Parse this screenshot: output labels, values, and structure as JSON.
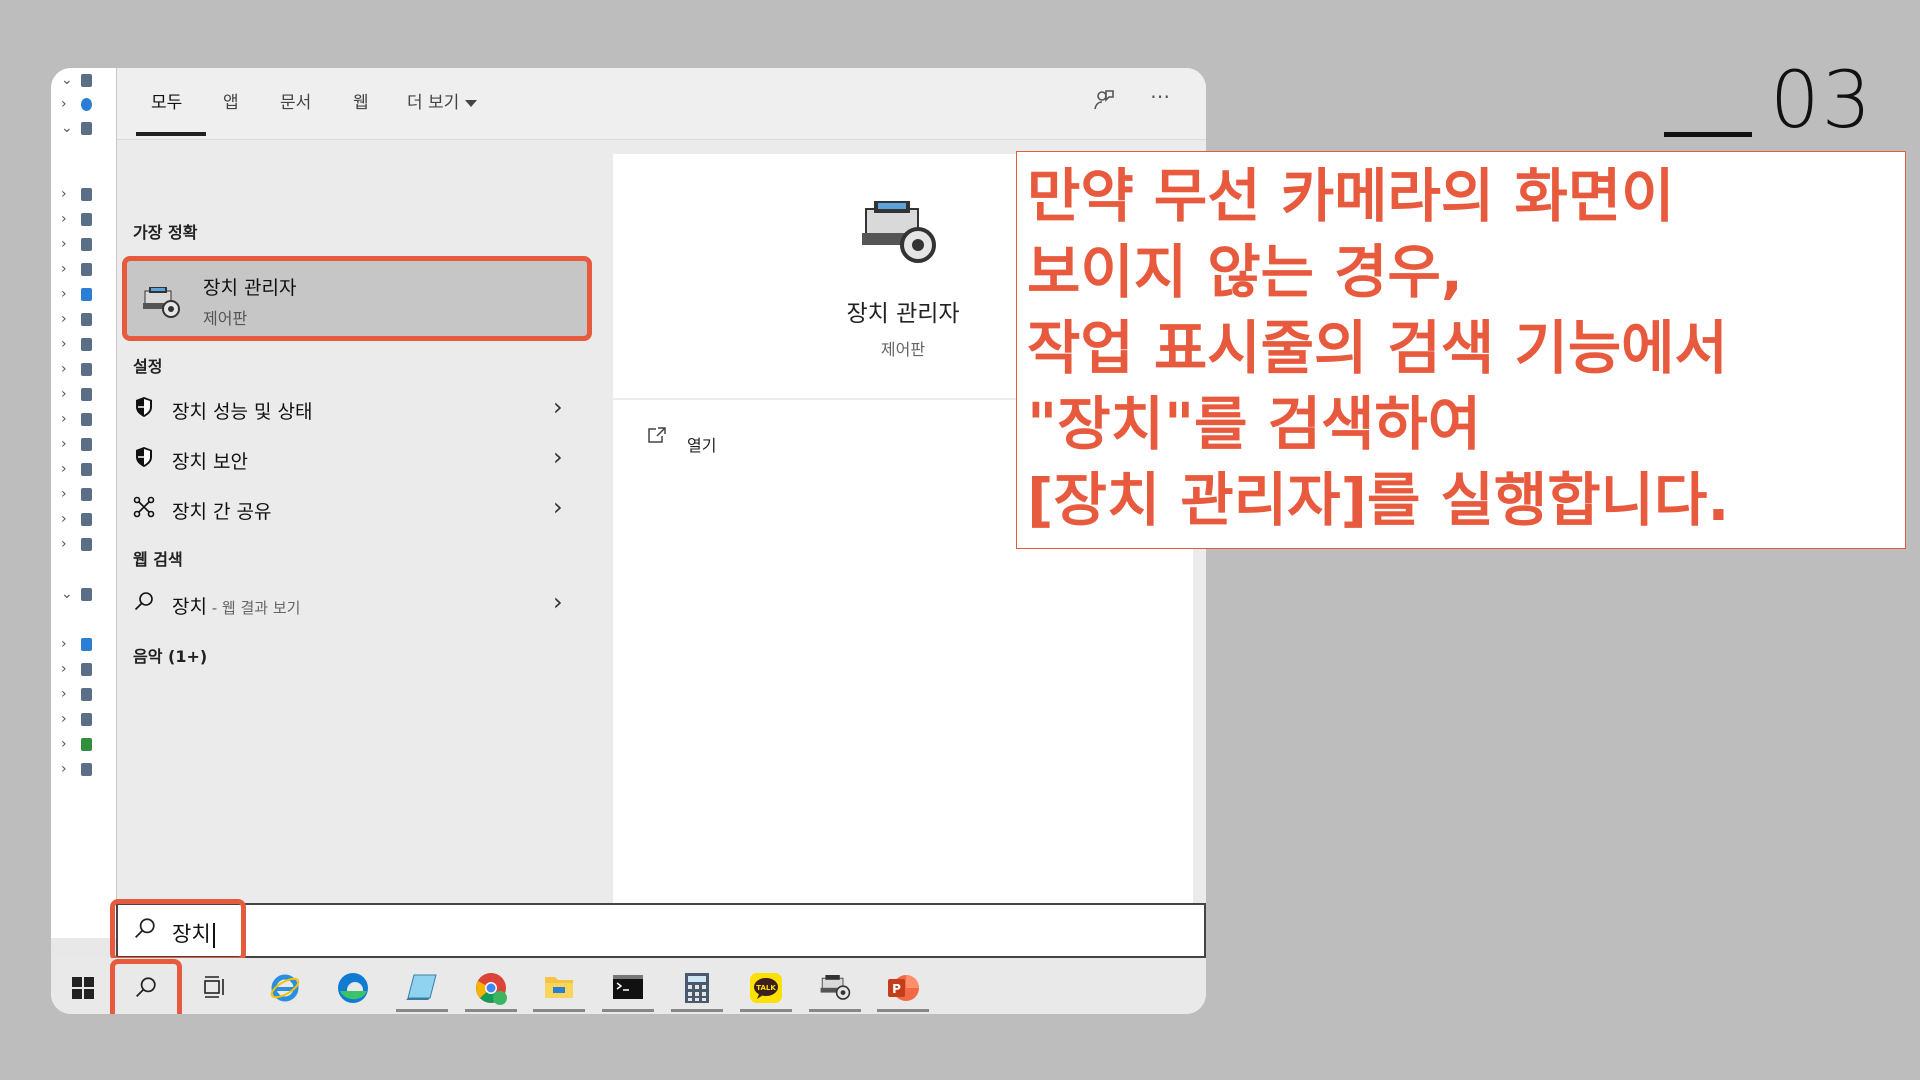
{
  "slide_number": "03",
  "tabs": [
    "모두",
    "앱",
    "문서",
    "웹",
    "더 보기"
  ],
  "tab_icons": [
    "feedback-icon",
    "more-options-icon"
  ],
  "sections": {
    "best_match": "가장 정확",
    "settings": "설정",
    "web": "웹 검색",
    "music": "음악 (1+)"
  },
  "best_match": {
    "name": "장치 관리자",
    "source": "제어판"
  },
  "settings_items": [
    {
      "label": "장치 성능 및 상태",
      "icon": "shield-icon"
    },
    {
      "label": "장치 보안",
      "icon": "shield-icon"
    },
    {
      "label": "장치 간 공유",
      "icon": "share-icon"
    }
  ],
  "web_item": {
    "label": "장치",
    "sub": " - 웹 결과 보기"
  },
  "preview": {
    "name": "장치 관리자",
    "source": "제어판",
    "open": "열기"
  },
  "search": {
    "value": "장치"
  },
  "callout": {
    "lines": [
      "만약 무선 카메라의 화면이",
      "보이지 않는 경우,",
      "작업 표시줄의 검색 기능에서",
      "\"장치\"를 검색하여",
      "[장치 관리자]를 실행합니다."
    ]
  },
  "colors": {
    "accent": "#e85a3e",
    "background": "#bdbdbd"
  },
  "taskbar_icons": [
    "windows-start-icon",
    "search-icon",
    "task-view-icon",
    "internet-explorer-icon",
    "edge-icon",
    "notepad-icon",
    "chrome-icon",
    "file-explorer-icon",
    "terminal-icon",
    "calculator-icon",
    "kakaotalk-icon",
    "device-manager-icon",
    "powerpoint-icon"
  ]
}
